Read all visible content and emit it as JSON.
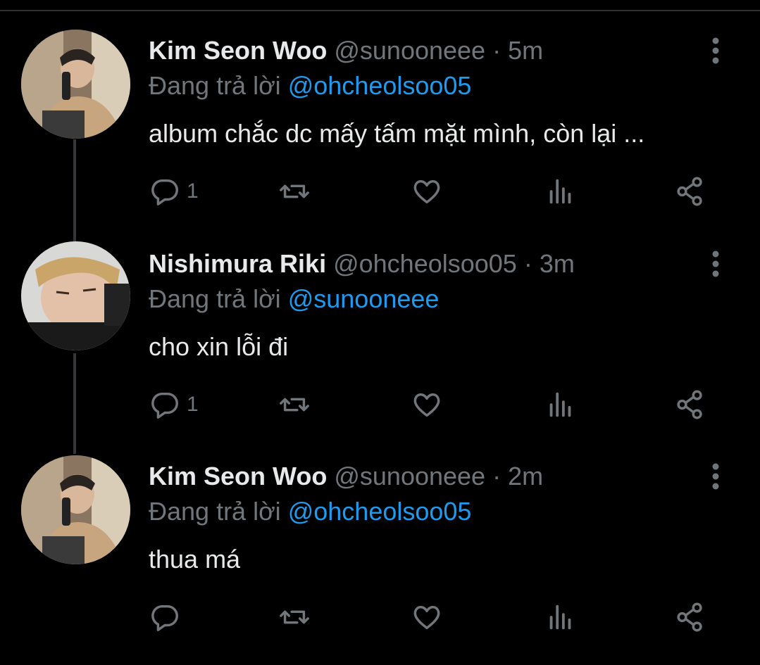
{
  "colors": {
    "background": "#000000",
    "text": "#e7e9ea",
    "muted": "#71767b",
    "link": "#1d9bf0"
  },
  "tweets": [
    {
      "name": "Kim Seon Woo",
      "handle": "@sunooneee",
      "time": "· 5m",
      "reply_prefix": "Đang trả lời",
      "reply_to": "@ohcheolsoo05",
      "text": "album chắc dc mấy tấm mặt mình, còn lại ...",
      "reply_count": "1",
      "icons": [
        "reply-icon",
        "retweet-icon",
        "like-icon",
        "views-icon",
        "share-icon",
        "more-icon"
      ]
    },
    {
      "name": "Nishimura Riki",
      "handle": "@ohcheolsoo05",
      "time": "· 3m",
      "reply_prefix": "Đang trả lời",
      "reply_to": "@sunooneee",
      "text": "cho xin lỗi đi",
      "reply_count": "1",
      "icons": [
        "reply-icon",
        "retweet-icon",
        "like-icon",
        "views-icon",
        "share-icon",
        "more-icon"
      ]
    },
    {
      "name": "Kim Seon Woo",
      "handle": "@sunooneee",
      "time": "· 2m",
      "reply_prefix": "Đang trả lời",
      "reply_to": "@ohcheolsoo05",
      "text": "thua má",
      "reply_count": "",
      "icons": [
        "reply-icon",
        "retweet-icon",
        "like-icon",
        "views-icon",
        "share-icon",
        "more-icon"
      ]
    }
  ]
}
